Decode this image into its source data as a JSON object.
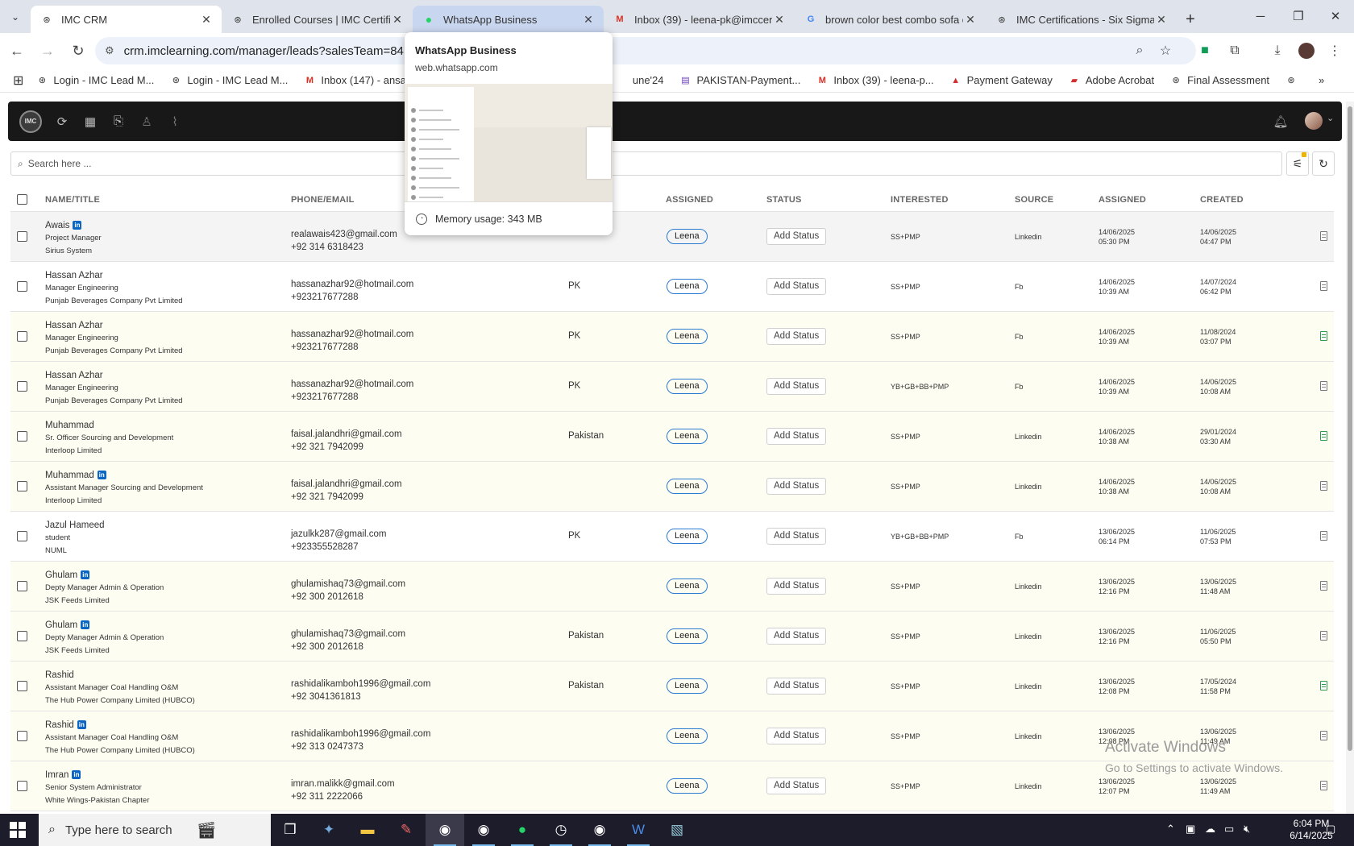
{
  "browser": {
    "tabs": [
      {
        "title": "IMC CRM",
        "favicon": "imc-logo-icon"
      },
      {
        "title": "Enrolled Courses | IMC Certifica",
        "favicon": "imc-logo-icon"
      },
      {
        "title": "WhatsApp Business",
        "favicon": "whatsapp-icon"
      },
      {
        "title": "Inbox (39) - leena-pk@imccerti",
        "favicon": "gmail-icon"
      },
      {
        "title": "brown color best combo sofa c",
        "favicon": "google-icon"
      },
      {
        "title": "IMC Certifications - Six Sigma C",
        "favicon": "imc-logo-icon"
      }
    ],
    "url": "crm.imclearning.com/manager/leads?salesTeam=84",
    "bookmarks": [
      {
        "label": "Login - IMC Lead M...",
        "icon": "imc-logo-icon"
      },
      {
        "label": "Login - IMC Lead M...",
        "icon": "imc-logo-icon"
      },
      {
        "label": "Inbox (147) - ansaril...",
        "icon": "gmail-icon"
      },
      {
        "label": "une'24",
        "icon": "none"
      },
      {
        "label": "PAKISTAN-Payment...",
        "icon": "forms-icon"
      },
      {
        "label": "Inbox (39) - leena-p...",
        "icon": "gmail-icon"
      },
      {
        "label": "Payment Gateway",
        "icon": "payment-icon"
      },
      {
        "label": "Adobe Acrobat",
        "icon": "acrobat-icon"
      },
      {
        "label": "Final Assessment",
        "icon": "imc-logo-icon"
      }
    ],
    "preview": {
      "title": "WhatsApp Business",
      "url": "web.whatsapp.com",
      "memory": "Memory usage: 343 MB"
    }
  },
  "app": {
    "logo_text": "IMC",
    "search_placeholder": "Search here ...",
    "columns": [
      "NAME/TITLE",
      "PHONE/EMAIL",
      "ASSIGNED",
      "STATUS",
      "INTERESTED",
      "SOURCE",
      "ASSIGNED",
      "CREATED"
    ]
  },
  "rows": [
    {
      "name": "Awais",
      "linkedin": true,
      "title": "Project Manager",
      "company": "Sirius System",
      "email": "realawais423@gmail.com",
      "phone": "+92 314 6318423",
      "location": "",
      "assigned": "Leena",
      "status": "Add Status",
      "interested": "SS+PMP",
      "source": "Linkedin",
      "assigned_date": "14/06/2025",
      "assigned_time": "05:30 PM",
      "created_date": "14/06/2025",
      "created_time": "04:47 PM",
      "doc": "gray",
      "bg": "g"
    },
    {
      "name": "Hassan Azhar",
      "linkedin": false,
      "title": "Manager Engineering",
      "company": "Punjab Beverages Company Pvt Limited",
      "email": "hassanazhar92@hotmail.com",
      "phone": "+923217677288",
      "location": "PK",
      "assigned": "Leena",
      "status": "Add Status",
      "interested": "SS+PMP",
      "source": "Fb",
      "assigned_date": "14/06/2025",
      "assigned_time": "10:39 AM",
      "created_date": "14/07/2024",
      "created_time": "06:42 PM",
      "doc": "gray",
      "bg": "w"
    },
    {
      "name": "Hassan Azhar",
      "linkedin": false,
      "title": "Manager Engineering",
      "company": "Punjab Beverages Company Pvt Limited",
      "email": "hassanazhar92@hotmail.com",
      "phone": "+923217677288",
      "location": "PK",
      "assigned": "Leena",
      "status": "Add Status",
      "interested": "SS+PMP",
      "source": "Fb",
      "assigned_date": "14/06/2025",
      "assigned_time": "10:39 AM",
      "created_date": "11/08/2024",
      "created_time": "03:07 PM",
      "doc": "green",
      "bg": "y"
    },
    {
      "name": "Hassan Azhar",
      "linkedin": false,
      "title": "Manager Engineering",
      "company": "Punjab Beverages Company Pvt Limited",
      "email": "hassanazhar92@hotmail.com",
      "phone": "+923217677288",
      "location": "PK",
      "assigned": "Leena",
      "status": "Add Status",
      "interested": "YB+GB+BB+PMP",
      "source": "Fb",
      "assigned_date": "14/06/2025",
      "assigned_time": "10:39 AM",
      "created_date": "14/06/2025",
      "created_time": "10:08 AM",
      "doc": "gray",
      "bg": "y"
    },
    {
      "name": "Muhammad",
      "linkedin": false,
      "title": "Sr. Officer Sourcing and Development",
      "company": "Interloop Limited",
      "email": "faisal.jalandhri@gmail.com",
      "phone": "+92 321 7942099",
      "location": "Pakistan",
      "assigned": "Leena",
      "status": "Add Status",
      "interested": "SS+PMP",
      "source": "Linkedin",
      "assigned_date": "14/06/2025",
      "assigned_time": "10:38 AM",
      "created_date": "29/01/2024",
      "created_time": "03:30 AM",
      "doc": "green",
      "bg": "y"
    },
    {
      "name": "Muhammad",
      "linkedin": true,
      "title": "Assistant Manager Sourcing and Development",
      "company": "Interloop Limited",
      "email": "faisal.jalandhri@gmail.com",
      "phone": "+92 321 7942099",
      "location": "",
      "assigned": "Leena",
      "status": "Add Status",
      "interested": "SS+PMP",
      "source": "Linkedin",
      "assigned_date": "14/06/2025",
      "assigned_time": "10:38 AM",
      "created_date": "14/06/2025",
      "created_time": "10:08 AM",
      "doc": "gray",
      "bg": "y"
    },
    {
      "name": "Jazul Hameed",
      "linkedin": false,
      "title": "student",
      "company": "NUML",
      "email": "jazulkk287@gmail.com",
      "phone": "+923355528287",
      "location": "PK",
      "assigned": "Leena",
      "status": "Add Status",
      "interested": "YB+GB+BB+PMP",
      "source": "Fb",
      "assigned_date": "13/06/2025",
      "assigned_time": "06:14 PM",
      "created_date": "11/06/2025",
      "created_time": "07:53 PM",
      "doc": "gray",
      "bg": "w"
    },
    {
      "name": "Ghulam",
      "linkedin": true,
      "title": "Depty Manager Admin & Operation",
      "company": "JSK Feeds Limited",
      "email": "ghulamishaq73@gmail.com",
      "phone": "+92 300 2012618",
      "location": "",
      "assigned": "Leena",
      "status": "Add Status",
      "interested": "SS+PMP",
      "source": "Linkedin",
      "assigned_date": "13/06/2025",
      "assigned_time": "12:16 PM",
      "created_date": "13/06/2025",
      "created_time": "11:48 AM",
      "doc": "gray",
      "bg": "y"
    },
    {
      "name": "Ghulam",
      "linkedin": true,
      "title": "Depty Manager Admin & Operation",
      "company": "JSK Feeds Limited",
      "email": "ghulamishaq73@gmail.com",
      "phone": "+92 300 2012618",
      "location": "Pakistan",
      "assigned": "Leena",
      "status": "Add Status",
      "interested": "SS+PMP",
      "source": "Linkedin",
      "assigned_date": "13/06/2025",
      "assigned_time": "12:16 PM",
      "created_date": "11/06/2025",
      "created_time": "05:50 PM",
      "doc": "gray",
      "bg": "y"
    },
    {
      "name": "Rashid",
      "linkedin": false,
      "title": "Assistant Manager Coal Handling O&M",
      "company": "The Hub Power Company Limited (HUBCO)",
      "email": "rashidalikamboh1996@gmail.com",
      "phone": "+92 3041361813",
      "location": "Pakistan",
      "assigned": "Leena",
      "status": "Add Status",
      "interested": "SS+PMP",
      "source": "Linkedin",
      "assigned_date": "13/06/2025",
      "assigned_time": "12:08 PM",
      "created_date": "17/05/2024",
      "created_time": "11:58 PM",
      "doc": "green",
      "bg": "y"
    },
    {
      "name": "Rashid",
      "linkedin": true,
      "title": "Assistant Manager Coal Handling O&M",
      "company": "The Hub Power Company Limited (HUBCO)",
      "email": "rashidalikamboh1996@gmail.com",
      "phone": "+92 313 0247373",
      "location": "",
      "assigned": "Leena",
      "status": "Add Status",
      "interested": "SS+PMP",
      "source": "Linkedin",
      "assigned_date": "13/06/2025",
      "assigned_time": "12:08 PM",
      "created_date": "13/06/2025",
      "created_time": "11:49 AM",
      "doc": "gray",
      "bg": "y"
    },
    {
      "name": "Imran",
      "linkedin": true,
      "title": "Senior System Administrator",
      "company": "White Wings-Pakistan Chapter",
      "email": "imran.malikk@gmail.com",
      "phone": "+92 311 2222066",
      "location": "",
      "assigned": "Leena",
      "status": "Add Status",
      "interested": "SS+PMP",
      "source": "Linkedin",
      "assigned_date": "13/06/2025",
      "assigned_time": "12:07 PM",
      "created_date": "13/06/2025",
      "created_time": "11:49 AM",
      "doc": "gray",
      "bg": "y"
    }
  ],
  "watermark": {
    "line1": "Activate Windows",
    "line2": "Go to Settings to activate Windows."
  },
  "taskbar": {
    "search_placeholder": "Type here to search",
    "time": "6:04 PM",
    "date": "6/14/2025"
  }
}
